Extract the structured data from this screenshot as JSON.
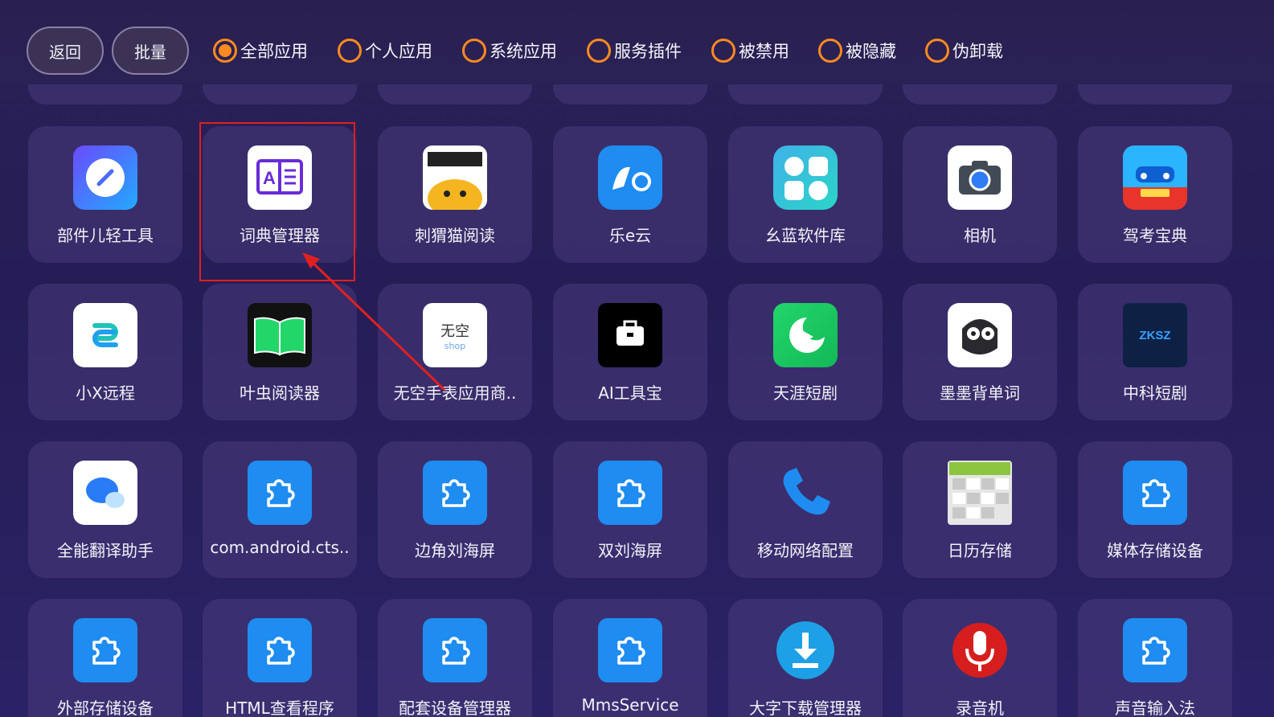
{
  "topbar": {
    "back_label": "返回",
    "batch_label": "批量",
    "filters": [
      {
        "label": "全部应用",
        "selected": true
      },
      {
        "label": "个人应用",
        "selected": false
      },
      {
        "label": "系统应用",
        "selected": false
      },
      {
        "label": "服务插件",
        "selected": false
      },
      {
        "label": "被禁用",
        "selected": false
      },
      {
        "label": "被隐藏",
        "selected": false
      },
      {
        "label": "伪卸载",
        "selected": false
      }
    ]
  },
  "apps": {
    "row1": [
      {
        "label": "部件儿轻工具",
        "icon": "compass-icon"
      },
      {
        "label": "词典管理器",
        "icon": "dictionary-icon"
      },
      {
        "label": "刺猬猫阅读",
        "icon": "cat-icon"
      },
      {
        "label": "乐e云",
        "icon": "cloud-le-icon"
      },
      {
        "label": "幺蓝软件库",
        "icon": "app-grid-icon"
      },
      {
        "label": "相机",
        "icon": "camera-icon"
      },
      {
        "label": "驾考宝典",
        "icon": "car-icon"
      }
    ],
    "row2": [
      {
        "label": "小X远程",
        "icon": "remote-link-icon"
      },
      {
        "label": "叶虫阅读器",
        "icon": "open-book-icon"
      },
      {
        "label": "无空手表应用商..",
        "icon": "wukong-shop-icon",
        "icon_text": "无空",
        "icon_sub": "shop"
      },
      {
        "label": "AI工具宝",
        "icon": "toolbox-icon"
      },
      {
        "label": "天涯短剧",
        "icon": "play-moon-icon"
      },
      {
        "label": "墨墨背单词",
        "icon": "owl-icon"
      },
      {
        "label": "中科短剧",
        "icon": "zksz-icon",
        "icon_text": "ZKSZ"
      }
    ],
    "row3": [
      {
        "label": "全能翻译助手",
        "icon": "chat-bubble-icon"
      },
      {
        "label": "com.android.cts..",
        "icon": "puzzle-icon"
      },
      {
        "label": "边角刘海屏",
        "icon": "puzzle-icon"
      },
      {
        "label": "双刘海屏",
        "icon": "puzzle-icon"
      },
      {
        "label": "移动网络配置",
        "icon": "phone-icon"
      },
      {
        "label": "日历存储",
        "icon": "calendar-icon"
      },
      {
        "label": "媒体存储设备",
        "icon": "puzzle-icon"
      }
    ],
    "row4": [
      {
        "label": "外部存储设备",
        "icon": "puzzle-icon"
      },
      {
        "label": "HTML查看程序",
        "icon": "puzzle-icon"
      },
      {
        "label": "配套设备管理器",
        "icon": "puzzle-icon"
      },
      {
        "label": "MmsService",
        "icon": "puzzle-icon"
      },
      {
        "label": "大字下载管理器",
        "icon": "download-icon"
      },
      {
        "label": "录音机",
        "icon": "microphone-icon"
      },
      {
        "label": "声音输入法",
        "icon": "puzzle-icon"
      }
    ]
  },
  "colors": {
    "accent": "#ff8a1f",
    "highlight": "#e02020",
    "app_blue": "#1e8cf0"
  }
}
